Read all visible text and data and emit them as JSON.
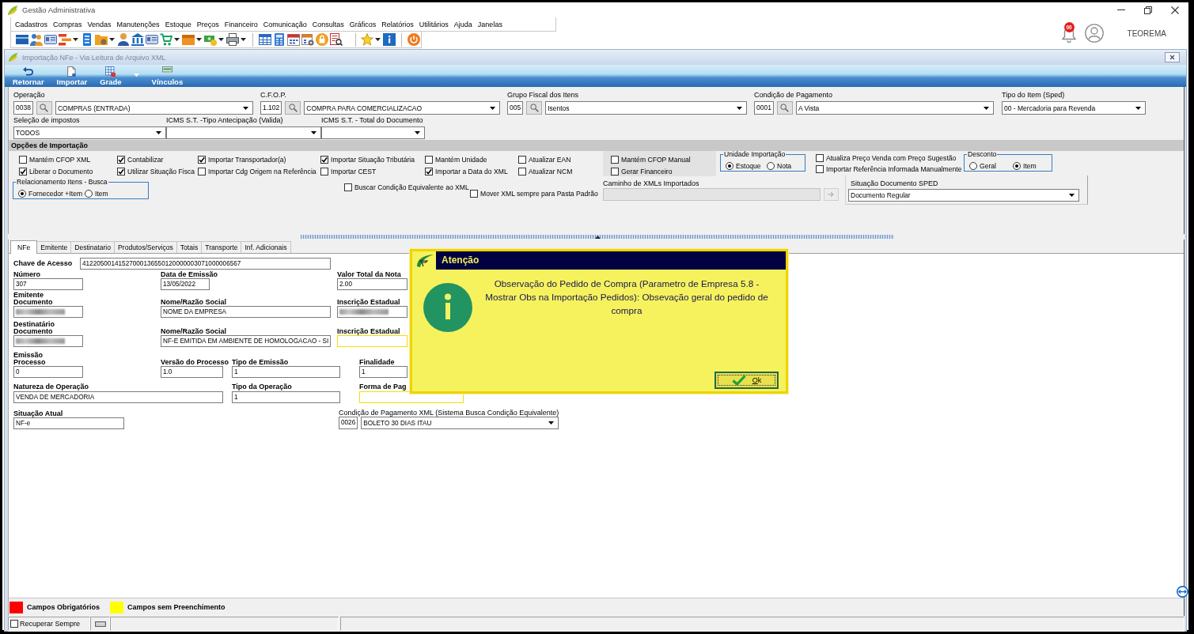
{
  "window": {
    "title": "Gestão Administrativa"
  },
  "menu": [
    "Cadastros",
    "Compras",
    "Vendas",
    "Manutenções",
    "Estoque",
    "Preços",
    "Financeiro",
    "Comunicação",
    "Consultas",
    "Gráficos",
    "Relatórios",
    "Utilitários",
    "Ajuda",
    "Janelas"
  ],
  "user_area": {
    "notification_count": "00",
    "user_name": "TEOREMA"
  },
  "child_window": {
    "title": "Importação NFe - Via Leitura de Arquivo XML",
    "ribbon": [
      {
        "label": "Retornar",
        "has_menu": false
      },
      {
        "label": "Importar",
        "has_menu": false
      },
      {
        "label": "Grade",
        "has_menu": true
      },
      {
        "label": "Vínculos",
        "has_menu": false
      }
    ]
  },
  "header_fields": [
    [
      {
        "kind": "lookup",
        "label": "Operação",
        "code": "0038",
        "value": "COMPRAS (ENTRADA)"
      },
      {
        "kind": "lookup",
        "label": "C.F.O.P.",
        "code": "1.102",
        "value": "COMPRA PARA COMERCIALIZACAO"
      },
      {
        "kind": "lookup",
        "label": "Grupo Fiscal dos Itens",
        "code": "005",
        "value": "Isentos"
      },
      {
        "kind": "lookup",
        "label": "Condição de Pagamento",
        "code": "0001",
        "value": "A Vista"
      },
      {
        "kind": "combo",
        "label": "Tipo do Item (Sped)",
        "value": "00 - Mercadoria para Revenda"
      }
    ],
    [
      {
        "kind": "combo",
        "label": "Seleção de impostos",
        "value": "TODOS"
      },
      {
        "kind": "combo",
        "label": "ICMS S.T. -Tipo Antecipação (Valida)"
      },
      {
        "kind": "combo",
        "label": "ICMS S.T. - Total do Documento"
      }
    ]
  ],
  "import_options": {
    "title": "Opções de Importação",
    "columns": [
      [
        {
          "label": "Mantém CFOP XML",
          "checked": false
        },
        {
          "label": "Liberar o Documento",
          "checked": true
        }
      ],
      [
        {
          "label": "Contabilizar",
          "checked": true
        },
        {
          "label": "Utilizar Situação Fisca",
          "checked": true
        }
      ],
      [
        {
          "label": "Importar Transportador(a)",
          "checked": true
        },
        {
          "label": "Importar Cdg Origem na Referência",
          "checked": false
        }
      ],
      [
        {
          "label": "Importar Situação Tributária",
          "checked": true
        },
        {
          "label": "Importar CEST",
          "checked": false
        }
      ],
      [
        {
          "label": "Mantém Unidade",
          "checked": false
        },
        {
          "label": "Importar a Data do XML",
          "checked": true
        }
      ],
      [
        {
          "label": "Atualizar EAN",
          "checked": false
        },
        {
          "label": "Atualizar NCM",
          "checked": false
        }
      ]
    ],
    "manual_panel": [
      {
        "label": "Mantém CFOP Manual",
        "checked": false
      },
      {
        "label": "Gerar Financeiro",
        "checked": false
      }
    ],
    "unit_group": {
      "title": "Unidade Importação",
      "options": [
        {
          "label": "Estoque",
          "selected": true
        },
        {
          "label": "Nota",
          "selected": false
        }
      ]
    },
    "price_options": [
      {
        "label": "Atualiza Preço Venda com Preço Sugestão",
        "checked": false
      },
      {
        "label": "Importar Referência Informada Manualmente",
        "checked": false
      }
    ],
    "discount_group": {
      "title": "Desconto",
      "options": [
        {
          "label": "Geral",
          "selected": false
        },
        {
          "label": "Item",
          "selected": true
        }
      ]
    },
    "item_search_group": {
      "title": "Relacionamento Itens - Busca",
      "options": [
        {
          "label": "Fornecedor +Item",
          "selected": true
        },
        {
          "label": "Item",
          "selected": false
        }
      ]
    },
    "extra_options": [
      {
        "label": "Buscar Condição Equivalente ao XML",
        "checked": false
      },
      {
        "label": "Mover XML sempre para Pasta Padrão",
        "checked": false
      }
    ],
    "xml_path": {
      "label": "Caminho de XMLs Importados",
      "disabled": true
    },
    "sped_status": {
      "label": "Situação Documento SPED",
      "value": "Documento Regular"
    }
  },
  "tabs": [
    {
      "label": "NFe",
      "selected": true
    },
    {
      "label": "Emitente",
      "selected": false
    },
    {
      "label": "Destinatario",
      "selected": false
    },
    {
      "label": "Produtos/Serviços",
      "selected": false
    },
    {
      "label": "Totais",
      "selected": false
    },
    {
      "label": "Transporte",
      "selected": false
    },
    {
      "label": "Inf. Adicionais",
      "selected": false
    }
  ],
  "nfe": {
    "access_key": {
      "label": "Chave de Acesso",
      "value": "41220500141527000136550120000003071000006567"
    },
    "rows": [
      {
        "fields": [
          {
            "kind": "text",
            "label": "Número",
            "value": "307",
            "unfilled": false
          },
          {
            "kind": "text",
            "label": "Data de Emissão",
            "value": "13/05/2022",
            "unfilled": false
          },
          {
            "kind": "text",
            "label": "Valor Total da Nota",
            "value": "2.00",
            "unfilled": false
          }
        ]
      },
      {
        "section": "Emitente",
        "fields": [
          {
            "kind": "redacted",
            "label": "Documento",
            "unfilled": false
          },
          {
            "kind": "text",
            "label": "Nome/Razão Social",
            "value": "NOME DA EMPRESA",
            "unfilled": false
          },
          {
            "kind": "redacted",
            "label": "Inscrição Estadual",
            "unfilled": false
          }
        ]
      },
      {
        "section": "Destinatário",
        "fields": [
          {
            "kind": "redacted",
            "label": "Documento",
            "unfilled": false
          },
          {
            "kind": "text",
            "label": "Nome/Razão Social",
            "value": "NF-E EMITIDA EM AMBIENTE DE HOMOLOGACAO - SI",
            "unfilled": false
          },
          {
            "kind": "text",
            "label": "Inscrição Estadual",
            "unfilled": true
          }
        ]
      },
      {
        "section": "Emissão",
        "fields": [
          {
            "kind": "text",
            "label": "Processo",
            "value": "0",
            "unfilled": false
          },
          {
            "kind": "text",
            "label": "Versão do Processo",
            "value": "1.0",
            "unfilled": false
          },
          {
            "kind": "text",
            "label": "Tipo de Emissão",
            "value": "1",
            "unfilled": false
          },
          {
            "kind": "text",
            "label": "Finalidade",
            "value": "1",
            "unfilled": false
          }
        ]
      },
      {
        "fields": [
          {
            "kind": "text",
            "label": "Natureza de Operação",
            "value": "VENDA DE MERCADORIA",
            "unfilled": false
          },
          {
            "kind": "text",
            "label": "Tipo da Operação",
            "value": "1",
            "unfilled": false
          },
          {
            "kind": "text",
            "label": "Forma de Pag",
            "unfilled": true
          }
        ]
      },
      {
        "fields": [
          {
            "kind": "text",
            "label": "Situação Atual",
            "value": "NF-e",
            "unfilled": false
          },
          {
            "kind": "lookup",
            "label": "Condição de Pagamento XML (Sistema Busca Condição Equivalente)",
            "code": "0026",
            "value": "BOLETO 30 DIAS ITAU",
            "unfilled": false
          }
        ]
      }
    ]
  },
  "dialog": {
    "title": "Atenção",
    "message": "Observação do Pedido de Compra (Parametro de Empresa 5.8 - Mostrar Obs na Importação Pedidos): Obsevação geral do pedido de compra",
    "button": "Ok"
  },
  "legend": [
    {
      "label": "Campos Obrigatórios",
      "color": "#ff0000"
    },
    {
      "label": "Campos sem Preenchimento",
      "color": "#ffff00"
    }
  ],
  "status_bar": {
    "remember": {
      "label": "Recuperar Sempre",
      "checked": false
    }
  }
}
